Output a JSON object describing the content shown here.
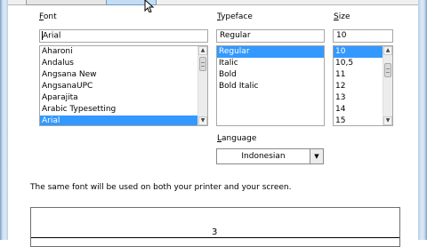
{
  "font": {
    "label_prefix": "",
    "label_access": "F",
    "label_rest": "ont",
    "value": "Arial",
    "items": [
      "Aharoni",
      "Andalus",
      "Angsana New",
      "AngsanaUPC",
      "Aparajita",
      "Arabic Typesetting",
      "Arial"
    ],
    "selected_index": 6
  },
  "typeface": {
    "label_access": "T",
    "label_rest": "ypeface",
    "value": "Regular",
    "items": [
      "Regular",
      "Italic",
      "Bold",
      "Bold Italic"
    ],
    "selected_index": 0
  },
  "size": {
    "label_access": "S",
    "label_rest": "ize",
    "value": "10",
    "items": [
      "10",
      "10,5",
      "11",
      "12",
      "13",
      "14",
      "15"
    ],
    "selected_index": 0
  },
  "language": {
    "label_access": "L",
    "label_rest": "anguage",
    "value": "Indonesian"
  },
  "note": "The same font will be used on both your printer and your screen.",
  "preview": {
    "text": "3"
  },
  "icons": {
    "scroll_up": "▲",
    "scroll_down": "▼",
    "dropdown": "▼"
  },
  "colors": {
    "selection": "#3399ff"
  }
}
